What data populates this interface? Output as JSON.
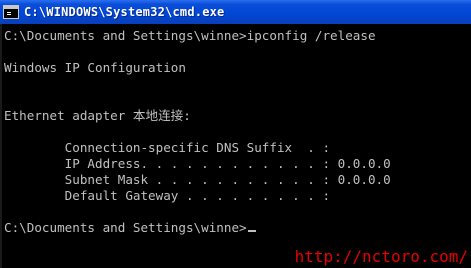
{
  "window": {
    "title": "C:\\WINDOWS\\System32\\cmd.exe",
    "icon": "cmd-icon"
  },
  "console": {
    "lines": [
      "C:\\Documents and Settings\\winne>ipconfig /release",
      "",
      "Windows IP Configuration",
      "",
      "",
      "Ethernet adapter 本地连接:",
      "",
      "        Connection-specific DNS Suffix  . :",
      "        IP Address. . . . . . . . . . . . : 0.0.0.0",
      "        Subnet Mask . . . . . . . . . . . : 0.0.0.0",
      "        Default Gateway . . . . . . . . . :",
      "",
      "C:\\Documents and Settings\\winne>"
    ]
  },
  "watermark": "http://nctoro.com/"
}
